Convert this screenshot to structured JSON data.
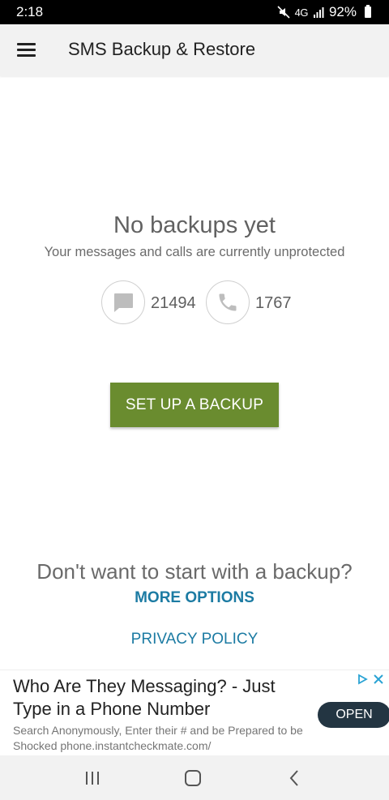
{
  "status_bar": {
    "time": "2:18",
    "network": "4G",
    "battery": "92%"
  },
  "app_bar": {
    "title": "SMS Backup & Restore"
  },
  "empty_state": {
    "title": "No backups yet",
    "subtitle": "Your messages and calls are currently unprotected",
    "sms_count": "21494",
    "call_count": "1767",
    "setup_button": "SET UP A BACKUP"
  },
  "footer": {
    "question": "Don't want to start with a backup?",
    "more_options": "MORE OPTIONS",
    "privacy_policy": "PRIVACY POLICY"
  },
  "ad": {
    "headline": "Who Are They Messaging? - Just Type in a Phone Number",
    "body": "Search Anonymously, Enter their # and be Prepared to be Shocked phone.instantcheckmate.com/",
    "cta": "OPEN"
  },
  "colors": {
    "accent": "#6a8c2f",
    "link": "#1c7ba3",
    "ad_button": "#233542"
  },
  "icons": {
    "menu": "hamburger-menu-icon",
    "sms": "message-icon",
    "call": "phone-icon",
    "ad_choices": "ad-choices-icon",
    "ad_close": "close-icon",
    "nav_recents": "recents-icon",
    "nav_home": "home-icon",
    "nav_back": "back-icon"
  }
}
